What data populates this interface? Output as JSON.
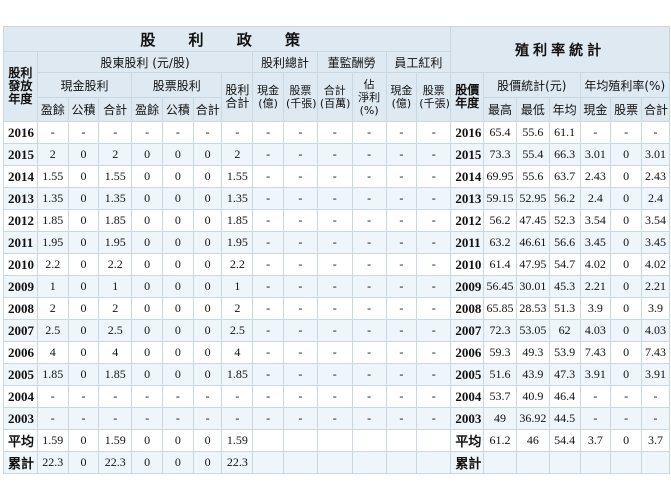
{
  "left": {
    "title": "股 利 政 策",
    "groups": {
      "shareholder_dividend": "股東股利 (元/股)",
      "total_dividend": "股利總計",
      "director_comp": "董監酬勞",
      "employee_bonus": "員工紅利"
    },
    "rowhead": "股利發放年度",
    "subgroups": {
      "cash": "現金股利",
      "stock": "股票股利",
      "div_total": "股利合計"
    },
    "cols": {
      "earn": "盈餘",
      "reserve": "公積",
      "sum": "合計",
      "cash_yi": "現金(億)",
      "stock_thousand": "股票(千張)",
      "total_million": "合計(百萬)",
      "est_ratio": "佔淨利(%)",
      "emp_cash": "現金(億)",
      "emp_stock": "股票(千張)"
    },
    "rows": [
      {
        "year": "2016",
        "v": [
          "-",
          "-",
          "-",
          "-",
          "-",
          "-",
          "-",
          "-",
          "-",
          "-",
          "-",
          "-",
          "-"
        ]
      },
      {
        "year": "2015",
        "v": [
          "2",
          "0",
          "2",
          "0",
          "0",
          "0",
          "2",
          "-",
          "-",
          "-",
          "-",
          "-",
          "-"
        ]
      },
      {
        "year": "2014",
        "v": [
          "1.55",
          "0",
          "1.55",
          "0",
          "0",
          "0",
          "1.55",
          "-",
          "-",
          "-",
          "-",
          "-",
          "-"
        ]
      },
      {
        "year": "2013",
        "v": [
          "1.35",
          "0",
          "1.35",
          "0",
          "0",
          "0",
          "1.35",
          "-",
          "-",
          "-",
          "-",
          "-",
          "-"
        ]
      },
      {
        "year": "2012",
        "v": [
          "1.85",
          "0",
          "1.85",
          "0",
          "0",
          "0",
          "1.85",
          "-",
          "-",
          "-",
          "-",
          "-",
          "-"
        ]
      },
      {
        "year": "2011",
        "v": [
          "1.95",
          "0",
          "1.95",
          "0",
          "0",
          "0",
          "1.95",
          "-",
          "-",
          "-",
          "-",
          "-",
          "-"
        ]
      },
      {
        "year": "2010",
        "v": [
          "2.2",
          "0",
          "2.2",
          "0",
          "0",
          "0",
          "2.2",
          "-",
          "-",
          "-",
          "-",
          "-",
          "-"
        ]
      },
      {
        "year": "2009",
        "v": [
          "1",
          "0",
          "1",
          "0",
          "0",
          "0",
          "1",
          "-",
          "-",
          "-",
          "-",
          "-",
          "-"
        ]
      },
      {
        "year": "2008",
        "v": [
          "2",
          "0",
          "2",
          "0",
          "0",
          "0",
          "2",
          "-",
          "-",
          "-",
          "-",
          "-",
          "-"
        ]
      },
      {
        "year": "2007",
        "v": [
          "2.5",
          "0",
          "2.5",
          "0",
          "0",
          "0",
          "2.5",
          "-",
          "-",
          "-",
          "-",
          "-",
          "-"
        ]
      },
      {
        "year": "2006",
        "v": [
          "4",
          "0",
          "4",
          "0",
          "0",
          "0",
          "4",
          "-",
          "-",
          "-",
          "-",
          "-",
          "-"
        ]
      },
      {
        "year": "2005",
        "v": [
          "1.85",
          "0",
          "1.85",
          "0",
          "0",
          "0",
          "1.85",
          "-",
          "-",
          "-",
          "-",
          "-",
          "-"
        ]
      },
      {
        "year": "2004",
        "v": [
          "-",
          "-",
          "-",
          "-",
          "-",
          "-",
          "-",
          "-",
          "-",
          "-",
          "-",
          "-",
          "-"
        ]
      },
      {
        "year": "2003",
        "v": [
          "-",
          "-",
          "-",
          "-",
          "-",
          "-",
          "-",
          "-",
          "-",
          "-",
          "-",
          "-",
          "-"
        ]
      },
      {
        "year": "平均",
        "v": [
          "1.59",
          "0",
          "1.59",
          "0",
          "0",
          "0",
          "1.59",
          "",
          "",
          "",
          "",
          "",
          ""
        ]
      },
      {
        "year": "累計",
        "v": [
          "22.3",
          "0",
          "22.3",
          "0",
          "0",
          "0",
          "22.3",
          "",
          "",
          "",
          "",
          "",
          ""
        ]
      }
    ]
  },
  "right": {
    "title": "殖利率統計",
    "rowhead": "股價年度",
    "groups": {
      "price": "股價統計(元)",
      "yield": "年均殖利率(%)"
    },
    "cols": [
      "最高",
      "最低",
      "年均",
      "現金",
      "股票",
      "合計"
    ],
    "rows": [
      {
        "year": "2016",
        "v": [
          "65.4",
          "55.6",
          "61.1",
          "-",
          "-",
          "-"
        ]
      },
      {
        "year": "2015",
        "v": [
          "73.3",
          "55.4",
          "66.3",
          "3.01",
          "0",
          "3.01"
        ]
      },
      {
        "year": "2014",
        "v": [
          "69.95",
          "55.6",
          "63.7",
          "2.43",
          "0",
          "2.43"
        ]
      },
      {
        "year": "2013",
        "v": [
          "59.15",
          "52.95",
          "56.2",
          "2.4",
          "0",
          "2.4"
        ]
      },
      {
        "year": "2012",
        "v": [
          "56.2",
          "47.45",
          "52.3",
          "3.54",
          "0",
          "3.54"
        ]
      },
      {
        "year": "2011",
        "v": [
          "63.2",
          "46.61",
          "56.6",
          "3.45",
          "0",
          "3.45"
        ]
      },
      {
        "year": "2010",
        "v": [
          "61.4",
          "47.95",
          "54.7",
          "4.02",
          "0",
          "4.02"
        ]
      },
      {
        "year": "2009",
        "v": [
          "56.45",
          "30.01",
          "45.3",
          "2.21",
          "0",
          "2.21"
        ]
      },
      {
        "year": "2008",
        "v": [
          "65.85",
          "28.53",
          "51.3",
          "3.9",
          "0",
          "3.9"
        ]
      },
      {
        "year": "2007",
        "v": [
          "72.3",
          "53.05",
          "62",
          "4.03",
          "0",
          "4.03"
        ]
      },
      {
        "year": "2006",
        "v": [
          "59.3",
          "49.3",
          "53.9",
          "7.43",
          "0",
          "7.43"
        ]
      },
      {
        "year": "2005",
        "v": [
          "51.6",
          "43.9",
          "47.3",
          "3.91",
          "0",
          "3.91"
        ]
      },
      {
        "year": "2004",
        "v": [
          "53.7",
          "40.9",
          "46.4",
          "-",
          "-",
          "-"
        ]
      },
      {
        "year": "2003",
        "v": [
          "49",
          "36.92",
          "44.5",
          "-",
          "-",
          "-"
        ]
      },
      {
        "year": "平均",
        "v": [
          "61.2",
          "46",
          "54.4",
          "3.7",
          "0",
          "3.7"
        ]
      },
      {
        "year": "累計",
        "v": [
          "",
          "",
          "",
          "",
          "",
          ""
        ]
      }
    ]
  }
}
